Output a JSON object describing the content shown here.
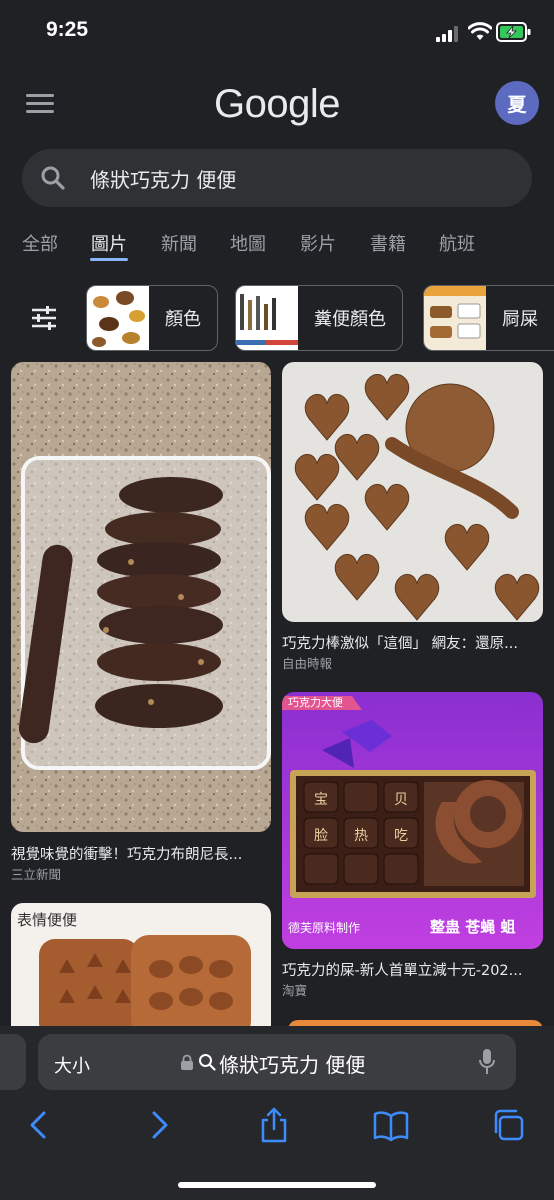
{
  "status_bar": {
    "time": "9:25"
  },
  "header": {
    "logo": "Google",
    "avatar_letter": "夏"
  },
  "search": {
    "query": "條狀巧克力 便便"
  },
  "tabs": [
    "全部",
    "圖片",
    "新聞",
    "地圖",
    "影片",
    "書籍",
    "航班"
  ],
  "active_tab": "圖片",
  "chips": [
    "顏色",
    "糞便顏色",
    "屙屎"
  ],
  "results": [
    {
      "caption": "視覺味覺的衝擊！巧克力布朗尼長...",
      "source": "三立新聞"
    },
    {
      "caption": "巧克力棒激似「這個」 網友：還原...",
      "source": "自由時報"
    },
    {
      "caption": "巧克力的屎-新人首單立減十元-202...",
      "source": "淘寶",
      "image_text": {
        "banner": "巧克力大便",
        "maker": "德芙原料制作",
        "tagline": "整蛊 苍蝇 蛆",
        "candy": [
          "宝",
          "贝",
          "脸",
          "热",
          "吃"
        ]
      }
    },
    {
      "image_text": {
        "label": "表情便便"
      }
    }
  ],
  "browser": {
    "text_size_label": "大小",
    "address": "條狀巧克力 便便"
  },
  "colors": {
    "background": "#202124",
    "search_box": "#303134",
    "accent": "#8ab4f8",
    "avatar": "#5c6bc0"
  }
}
